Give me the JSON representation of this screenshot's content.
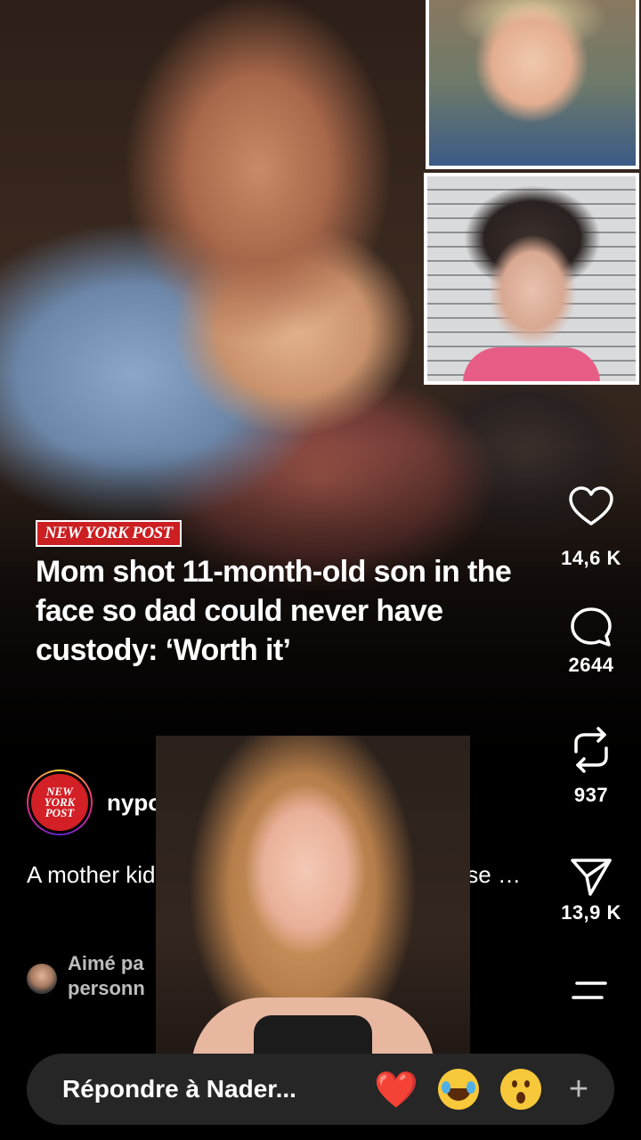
{
  "post": {
    "brand_tag": "NEW YORK POST",
    "headline": "Mom shot 11-month-old son in the face so dad could never have custody: ‘Worth it’",
    "author": {
      "username": "nypost",
      "avatar_text": "NEW YORK POST"
    },
    "caption": "A mother kid  month-old son and sho  because …",
    "liked_by": "Aimé pa personn"
  },
  "actions": {
    "likes": "14,6 K",
    "comments": "2644",
    "reposts": "937",
    "shares": "13,9 K"
  },
  "icons": {
    "like": "heart-icon",
    "comment": "comment-icon",
    "repost": "repost-icon",
    "share": "share-icon",
    "menu": "menu-icon",
    "add": "plus-icon"
  },
  "reply": {
    "placeholder": "Répondre à Nader...",
    "reactions": [
      "❤️",
      "😂",
      "😮"
    ],
    "add_symbol": "+"
  },
  "colors": {
    "brand_red": "#cc1f22",
    "reply_bar": "#262626",
    "background": "#000000"
  }
}
